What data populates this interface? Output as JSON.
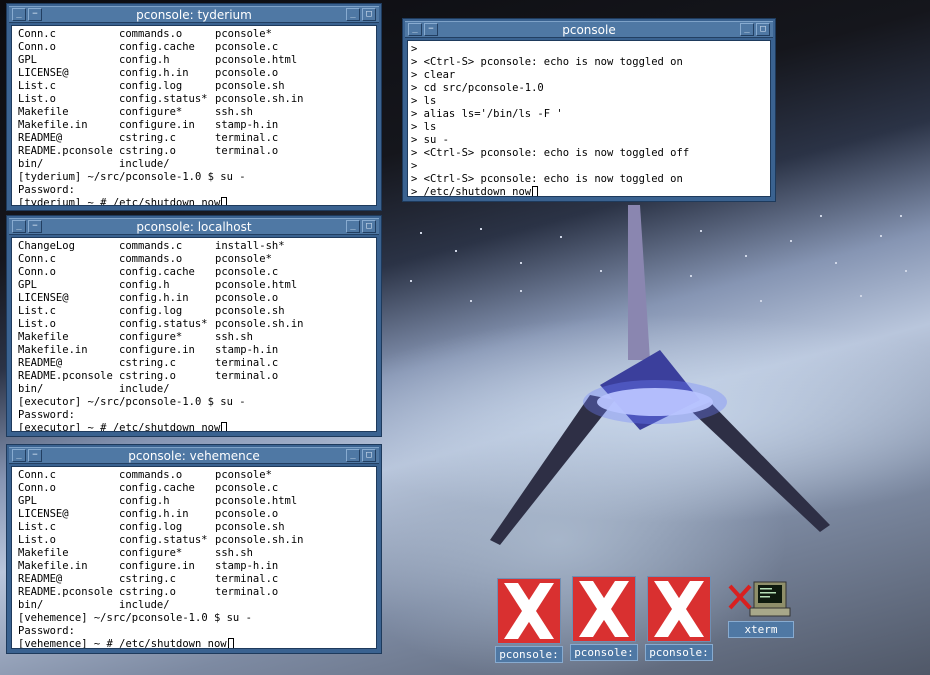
{
  "windows": {
    "tyderium": {
      "title": "pconsole: tyderium",
      "listing": [
        [
          "Conn.c",
          "commands.o",
          "pconsole*"
        ],
        [
          "Conn.o",
          "config.cache",
          "pconsole.c"
        ],
        [
          "GPL",
          "config.h",
          "pconsole.html"
        ],
        [
          "LICENSE@",
          "config.h.in",
          "pconsole.o"
        ],
        [
          "List.c",
          "config.log",
          "pconsole.sh"
        ],
        [
          "List.o",
          "config.status*",
          "pconsole.sh.in"
        ],
        [
          "Makefile",
          "configure*",
          "ssh.sh"
        ],
        [
          "Makefile.in",
          "configure.in",
          "stamp-h.in"
        ],
        [
          "README@",
          "cstring.c",
          "terminal.c"
        ],
        [
          "README.pconsole",
          "cstring.o",
          "terminal.o"
        ],
        [
          "bin/",
          "include/",
          ""
        ]
      ],
      "lines": [
        "[tyderium] ~/src/pconsole-1.0 $ su -",
        "Password:",
        "[tyderium] ~ # /etc/shutdown now"
      ]
    },
    "localhost": {
      "title": "pconsole: localhost",
      "listing": [
        [
          "ChangeLog",
          "commands.c",
          "install-sh*"
        ],
        [
          "Conn.c",
          "commands.o",
          "pconsole*"
        ],
        [
          "Conn.o",
          "config.cache",
          "pconsole.c"
        ],
        [
          "GPL",
          "config.h",
          "pconsole.html"
        ],
        [
          "LICENSE@",
          "config.h.in",
          "pconsole.o"
        ],
        [
          "List.c",
          "config.log",
          "pconsole.sh"
        ],
        [
          "List.o",
          "config.status*",
          "pconsole.sh.in"
        ],
        [
          "Makefile",
          "configure*",
          "ssh.sh"
        ],
        [
          "Makefile.in",
          "configure.in",
          "stamp-h.in"
        ],
        [
          "README@",
          "cstring.c",
          "terminal.c"
        ],
        [
          "README.pconsole",
          "cstring.o",
          "terminal.o"
        ],
        [
          "bin/",
          "include/",
          ""
        ]
      ],
      "lines": [
        "[executor] ~/src/pconsole-1.0 $ su -",
        "Password:",
        "[executor] ~ # /etc/shutdown now"
      ]
    },
    "vehemence": {
      "title": "pconsole: vehemence",
      "listing": [
        [
          "Conn.c",
          "commands.o",
          "pconsole*"
        ],
        [
          "Conn.o",
          "config.cache",
          "pconsole.c"
        ],
        [
          "GPL",
          "config.h",
          "pconsole.html"
        ],
        [
          "LICENSE@",
          "config.h.in",
          "pconsole.o"
        ],
        [
          "List.c",
          "config.log",
          "pconsole.sh"
        ],
        [
          "List.o",
          "config.status*",
          "pconsole.sh.in"
        ],
        [
          "Makefile",
          "configure*",
          "ssh.sh"
        ],
        [
          "Makefile.in",
          "configure.in",
          "stamp-h.in"
        ],
        [
          "README@",
          "cstring.c",
          "terminal.c"
        ],
        [
          "README.pconsole",
          "cstring.o",
          "terminal.o"
        ],
        [
          "bin/",
          "include/",
          ""
        ]
      ],
      "lines": [
        "[vehemence] ~/src/pconsole-1.0 $ su -",
        "Password:",
        "[vehemence] ~ # /etc/shutdown now"
      ]
    },
    "pconsole": {
      "title": "pconsole",
      "lines": [
        ">",
        "> <Ctrl-S> pconsole: echo is now toggled on",
        "> clear",
        "> cd src/pconsole-1.0",
        "> ls",
        "> alias ls='/bin/ls -F '",
        "> ls",
        "> su -",
        "> <Ctrl-S> pconsole: echo is now toggled off",
        ">",
        "> <Ctrl-S> pconsole: echo is now toggled on",
        "> /etc/shutdown now"
      ]
    }
  },
  "title_buttons": {
    "minimize": "_",
    "menu": "−",
    "maximize": "□"
  },
  "icons": [
    {
      "label": "pconsole:",
      "icon": "x-logo-icon"
    },
    {
      "label": "pconsole:",
      "icon": "x-logo-icon"
    },
    {
      "label": "pconsole:",
      "icon": "x-logo-icon"
    },
    {
      "label": "xterm",
      "icon": "xterm-icon"
    }
  ],
  "colors": {
    "titlebar": "#4f78a4",
    "frame": "#3a6290",
    "x_logo": "#d93030"
  }
}
